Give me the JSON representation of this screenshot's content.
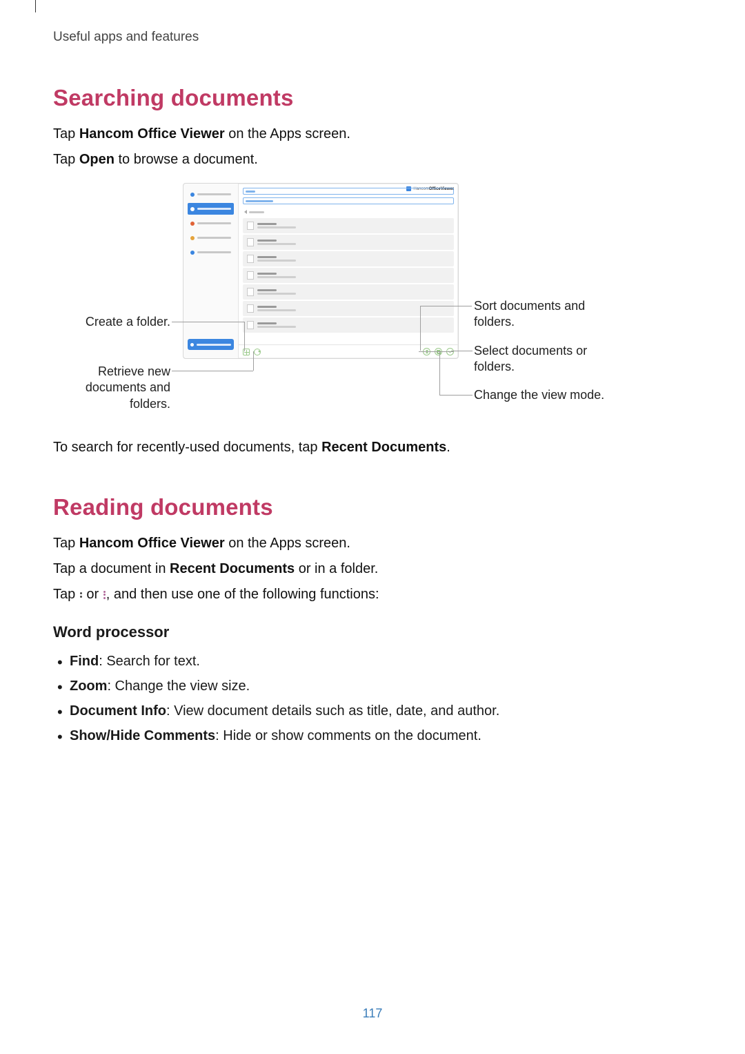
{
  "running_head": "Useful apps and features",
  "section1": {
    "title": "Searching documents",
    "p1_a": "Tap ",
    "p1_b": "Hancom Office Viewer",
    "p1_c": " on the Apps screen.",
    "p2_a": "Tap ",
    "p2_b": "Open",
    "p2_c": " to browse a document.",
    "p3_a": "To search for recently-used documents, tap ",
    "p3_b": "Recent Documents",
    "p3_c": "."
  },
  "figure": {
    "app_title_light": "Hancom",
    "app_title_bold": "OfficeViewer",
    "callouts": {
      "create_folder": "Create a folder.",
      "retrieve": "Retrieve new documents and folders.",
      "sort": "Sort documents and folders.",
      "select": "Select documents or folders.",
      "viewmode": "Change the view mode."
    }
  },
  "section2": {
    "title": "Reading documents",
    "p1_a": "Tap ",
    "p1_b": "Hancom Office Viewer",
    "p1_c": " on the Apps screen.",
    "p2_a": "Tap a document in ",
    "p2_b": "Recent Documents",
    "p2_c": " or in a folder.",
    "p3_a": "Tap ",
    "p3_b": " or ",
    "p3_c": ", and then use one of the following functions:",
    "sub": "Word processor",
    "items": [
      {
        "b": "Find",
        "t": ": Search for text."
      },
      {
        "b": "Zoom",
        "t": ": Change the view size."
      },
      {
        "b": "Document Info",
        "t": ": View document details such as title, date, and author."
      },
      {
        "b": "Show/Hide Comments",
        "t": ": Hide or show comments on the document."
      }
    ]
  },
  "page_number": "117"
}
